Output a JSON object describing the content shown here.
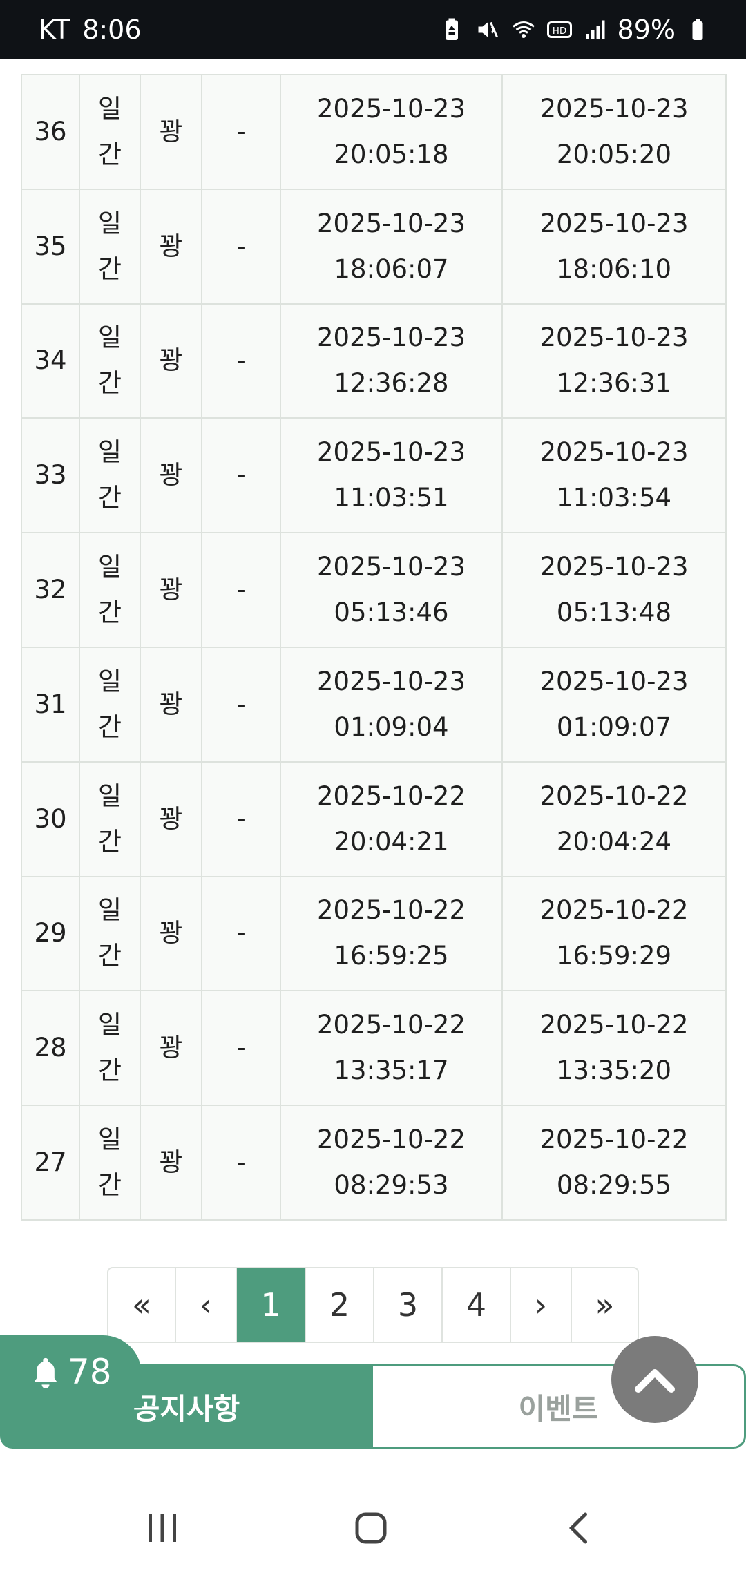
{
  "status_bar": {
    "carrier": "KT",
    "time": "8:06",
    "battery": "89%",
    "icons": [
      "battery-saver-icon",
      "mute-icon",
      "wifi-icon",
      "hd-icon",
      "signal-icon",
      "battery-icon"
    ]
  },
  "table": {
    "rows": [
      {
        "no": "36",
        "type": "일간",
        "result": "꽝",
        "dash": "-",
        "t1_date": "2025-10-23",
        "t1_time": "20:05:18",
        "t2_date": "2025-10-23",
        "t2_time": "20:05:20"
      },
      {
        "no": "35",
        "type": "일간",
        "result": "꽝",
        "dash": "-",
        "t1_date": "2025-10-23",
        "t1_time": "18:06:07",
        "t2_date": "2025-10-23",
        "t2_time": "18:06:10"
      },
      {
        "no": "34",
        "type": "일간",
        "result": "꽝",
        "dash": "-",
        "t1_date": "2025-10-23",
        "t1_time": "12:36:28",
        "t2_date": "2025-10-23",
        "t2_time": "12:36:31"
      },
      {
        "no": "33",
        "type": "일간",
        "result": "꽝",
        "dash": "-",
        "t1_date": "2025-10-23",
        "t1_time": "11:03:51",
        "t2_date": "2025-10-23",
        "t2_time": "11:03:54"
      },
      {
        "no": "32",
        "type": "일간",
        "result": "꽝",
        "dash": "-",
        "t1_date": "2025-10-23",
        "t1_time": "05:13:46",
        "t2_date": "2025-10-23",
        "t2_time": "05:13:48"
      },
      {
        "no": "31",
        "type": "일간",
        "result": "꽝",
        "dash": "-",
        "t1_date": "2025-10-23",
        "t1_time": "01:09:04",
        "t2_date": "2025-10-23",
        "t2_time": "01:09:07"
      },
      {
        "no": "30",
        "type": "일간",
        "result": "꽝",
        "dash": "-",
        "t1_date": "2025-10-22",
        "t1_time": "20:04:21",
        "t2_date": "2025-10-22",
        "t2_time": "20:04:24"
      },
      {
        "no": "29",
        "type": "일간",
        "result": "꽝",
        "dash": "-",
        "t1_date": "2025-10-22",
        "t1_time": "16:59:25",
        "t2_date": "2025-10-22",
        "t2_time": "16:59:29"
      },
      {
        "no": "28",
        "type": "일간",
        "result": "꽝",
        "dash": "-",
        "t1_date": "2025-10-22",
        "t1_time": "13:35:17",
        "t2_date": "2025-10-22",
        "t2_time": "13:35:20"
      },
      {
        "no": "27",
        "type": "일간",
        "result": "꽝",
        "dash": "-",
        "t1_date": "2025-10-22",
        "t1_time": "08:29:53",
        "t2_date": "2025-10-22",
        "t2_time": "08:29:55"
      }
    ]
  },
  "pagination": {
    "first": "«",
    "prev": "‹",
    "pages": [
      "1",
      "2",
      "3",
      "4"
    ],
    "active_page": "1",
    "next": "›",
    "last": "»"
  },
  "bottom_tabs": {
    "notice_count": "78",
    "notice_label": "공지사항",
    "event_label": "이벤트",
    "accent_color": "#4e9c7e"
  },
  "nav_bar": {
    "icons": [
      "recents-icon",
      "home-icon",
      "back-icon"
    ]
  }
}
